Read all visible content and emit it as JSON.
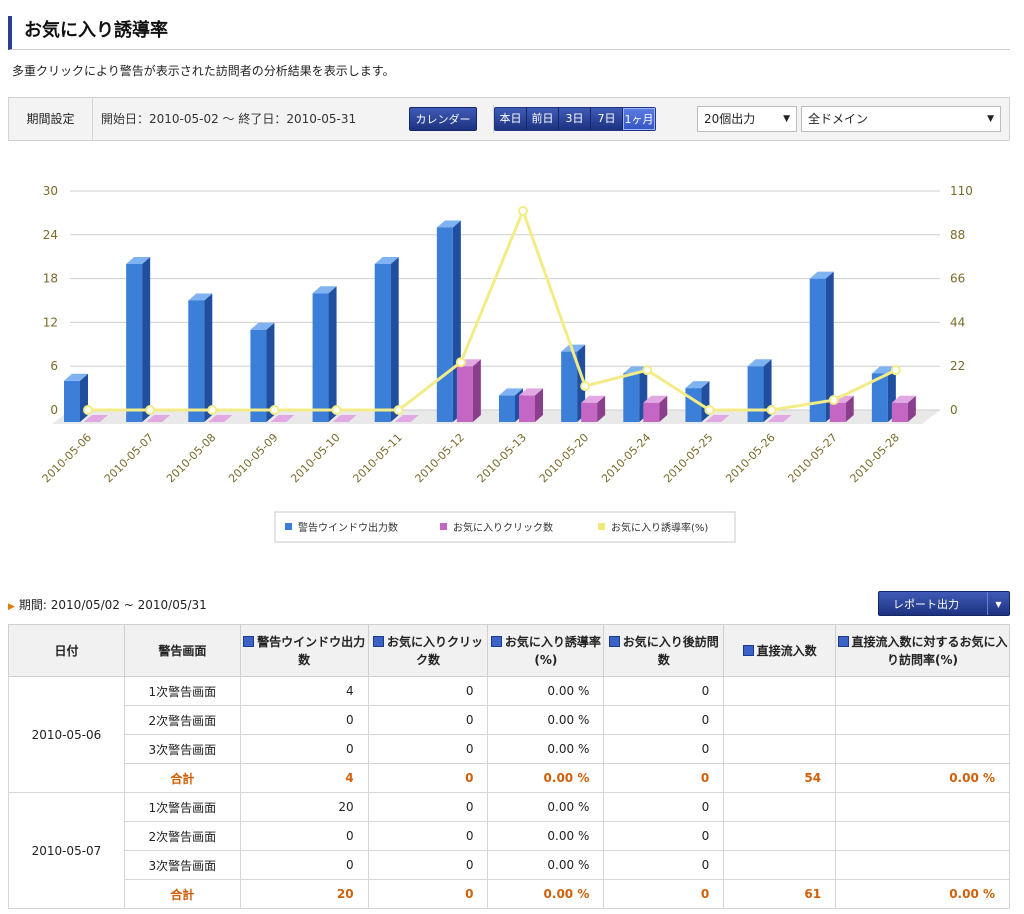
{
  "title": "お気に入り誘導率",
  "description": "多重クリックにより警告が表示された訪問者の分析結果を表示します。",
  "toolbar": {
    "period_label": "期間設定",
    "range_text": "開始日：2010-05-02 ～ 終了日：2010-05-31",
    "calendar_button": "カレンダー",
    "quick_ranges": [
      "本日",
      "前日",
      "3日",
      "7日",
      "1ヶ月"
    ],
    "quick_active_index": 4,
    "output_select": "20個出力",
    "domain_select": "全ドメイン"
  },
  "colors": {
    "accent": "#1d327f",
    "bar1": "#3b7fd8",
    "bar2": "#c366c4",
    "line": "#f0e878",
    "sum": "#d0600a"
  },
  "chart_data": {
    "type": "bar",
    "categories": [
      "2010-05-06",
      "2010-05-07",
      "2010-05-08",
      "2010-05-09",
      "2010-05-10",
      "2010-05-11",
      "2010-05-12",
      "2010-05-13",
      "2010-05-20",
      "2010-05-24",
      "2010-05-25",
      "2010-05-26",
      "2010-05-27",
      "2010-05-28"
    ],
    "series": [
      {
        "name": "警告ウインドウ出力数",
        "axis": "left",
        "type": "bar",
        "color": "#3b7fd8",
        "values": [
          4,
          20,
          15,
          11,
          16,
          20,
          25,
          2,
          8,
          5,
          3,
          6,
          18,
          5
        ]
      },
      {
        "name": "お気に入りクリック数",
        "axis": "left",
        "type": "bar",
        "color": "#c366c4",
        "values": [
          0,
          0,
          0,
          0,
          0,
          0,
          6,
          2,
          1,
          1,
          0,
          0,
          1,
          1
        ]
      },
      {
        "name": "お気に入り誘導率(%)",
        "axis": "right",
        "type": "line",
        "color": "#f0e878",
        "values": [
          0,
          0,
          0,
          0,
          0,
          0,
          24,
          100,
          12,
          20,
          0,
          0,
          5,
          20
        ]
      }
    ],
    "yticks_left": [
      "0",
      "6",
      "12",
      "18",
      "24",
      "30"
    ],
    "yticks_right": [
      "0",
      "22",
      "44",
      "66",
      "88",
      "110"
    ],
    "ylim_left": [
      0,
      30
    ],
    "ylim_right": [
      0,
      110
    ],
    "grid": true,
    "legend": "bottom"
  },
  "period_text": "期間: 2010/05/02 ~ 2010/05/31",
  "report_button": "レポート出力",
  "table": {
    "headers": [
      "日付",
      "警告画面",
      "警告ウインドウ出力数",
      "お気に入りクリック数",
      "お気に入り誘導率(%)",
      "お気に入り後訪問数",
      "直接流入数",
      "直接流入数に対するお気に入り訪問率(%)"
    ],
    "groups": [
      {
        "date": "2010-05-06",
        "rows": [
          {
            "screen": "1次警告画面",
            "warn": "4",
            "click": "0",
            "rate": "0.00 %",
            "after": "0"
          },
          {
            "screen": "2次警告画面",
            "warn": "0",
            "click": "0",
            "rate": "0.00 %",
            "after": "0"
          },
          {
            "screen": "3次警告画面",
            "warn": "0",
            "click": "0",
            "rate": "0.00 %",
            "after": "0"
          }
        ],
        "total": {
          "screen": "合計",
          "warn": "4",
          "click": "0",
          "rate": "0.00 %",
          "after": "0",
          "direct": "54",
          "direct_rate": "0.00 %"
        }
      },
      {
        "date": "2010-05-07",
        "rows": [
          {
            "screen": "1次警告画面",
            "warn": "20",
            "click": "0",
            "rate": "0.00 %",
            "after": "0"
          },
          {
            "screen": "2次警告画面",
            "warn": "0",
            "click": "0",
            "rate": "0.00 %",
            "after": "0"
          },
          {
            "screen": "3次警告画面",
            "warn": "0",
            "click": "0",
            "rate": "0.00 %",
            "after": "0"
          }
        ],
        "total": {
          "screen": "合計",
          "warn": "20",
          "click": "0",
          "rate": "0.00 %",
          "after": "0",
          "direct": "61",
          "direct_rate": "0.00 %"
        }
      }
    ]
  }
}
